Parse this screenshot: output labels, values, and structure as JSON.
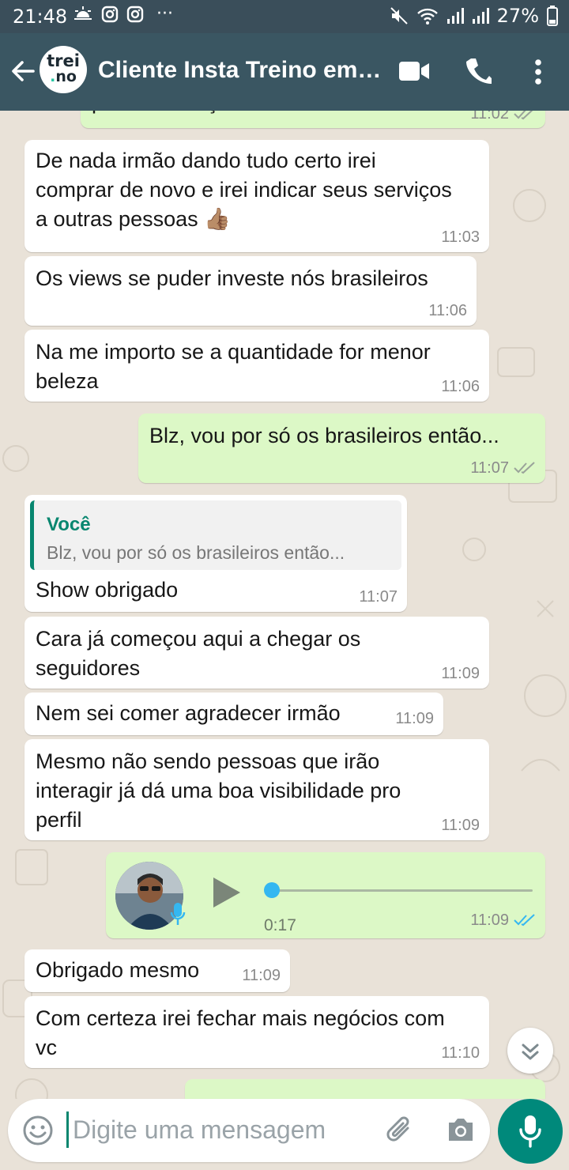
{
  "status_bar": {
    "time": "21:48",
    "battery": "27%",
    "more_label": "···"
  },
  "header": {
    "avatar_text_top": "trei",
    "avatar_text_bottom_dot": ".",
    "avatar_text_bottom": "no",
    "title": "Cliente Insta Treino em…",
    "accent_color": "#3a5662"
  },
  "messages": [
    {
      "dir": "out",
      "text": "pela confiança.",
      "time": "11:02",
      "ticks": "read-grey"
    },
    {
      "dir": "in",
      "text": "De nada irmão dando tudo certo irei comprar de novo e irei indicar seus serviços a outras pessoas 👍🏽",
      "time": "11:03"
    },
    {
      "dir": "in",
      "text": "Os views se puder investe nós brasileiros",
      "time": "11:06"
    },
    {
      "dir": "in",
      "text": "Na me importo se a quantidade for menor beleza",
      "time": "11:06"
    },
    {
      "dir": "out",
      "text": "Blz, vou por só os brasileiros então...",
      "time": "11:07",
      "ticks": "read-grey"
    },
    {
      "dir": "in",
      "quote_name": "Você",
      "quote_text": "Blz, vou por só os brasileiros então...",
      "text": "Show obrigado",
      "time": "11:07"
    },
    {
      "dir": "in",
      "text": "Cara já começou aqui a chegar os seguidores",
      "time": "11:09"
    },
    {
      "dir": "in",
      "text": "Nem sei comer agradecer irmão",
      "time": "11:09"
    },
    {
      "dir": "in",
      "text": "Mesmo não sendo pessoas que irão interagir já dá uma boa visibilidade pro perfil",
      "time": "11:09"
    },
    {
      "dir": "out",
      "type": "voice",
      "duration": "0:17",
      "time": "11:09",
      "ticks": "read-blue",
      "progress": 0
    },
    {
      "dir": "in",
      "text": "Obrigado mesmo",
      "time": "11:09"
    },
    {
      "dir": "in",
      "text": "Com certeza irei fechar mais negócios com vc",
      "time": "11:10"
    }
  ],
  "input": {
    "placeholder": "Digite uma mensagem",
    "value": ""
  },
  "colors": {
    "incoming": "#ffffff",
    "outgoing": "#dcf8c6",
    "read_tick_blue": "#34b7f1",
    "fab": "#00897b"
  },
  "icons": [
    "back-arrow-icon",
    "video-call-icon",
    "phone-icon",
    "more-vert-icon",
    "emoji-icon",
    "attach-icon",
    "camera-icon",
    "mic-icon",
    "play-icon",
    "chevron-down-icon"
  ]
}
